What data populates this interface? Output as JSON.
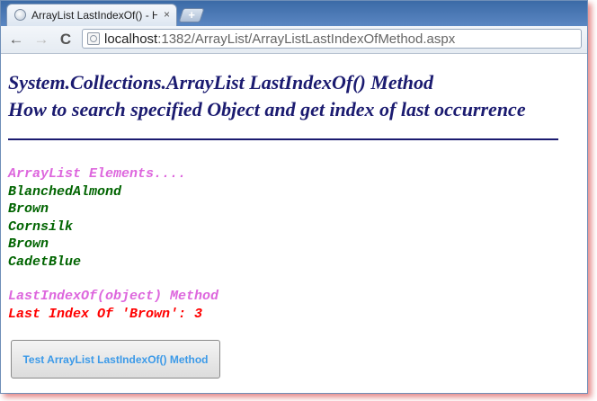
{
  "browser": {
    "tab_title": "ArrayList LastIndexOf() - Ho",
    "tab_close": "×",
    "new_tab": "+",
    "back": "←",
    "forward": "→",
    "reload": "C",
    "url_host": "localhost",
    "url_path": ":1382/ArrayList/ArrayListLastIndexOfMethod.aspx"
  },
  "page": {
    "heading_line1": "System.Collections.ArrayList LastIndexOf() Method",
    "heading_line2": "How to search specified Object and get index of last occurrence",
    "elements_label": "ArrayList Elements....",
    "elements": [
      "BlanchedAlmond",
      "Brown",
      "Cornsilk",
      "Brown",
      "CadetBlue"
    ],
    "method_label": "LastIndexOf(object) Method",
    "result": "Last Index Of 'Brown': 3",
    "button_label": "Test ArrayList LastIndexOf() Method"
  },
  "colors": {
    "heading": "#1b1b70",
    "label": "#dd66dd",
    "item": "#006400",
    "result": "#ff0000",
    "button_text": "#3c9ae8"
  }
}
